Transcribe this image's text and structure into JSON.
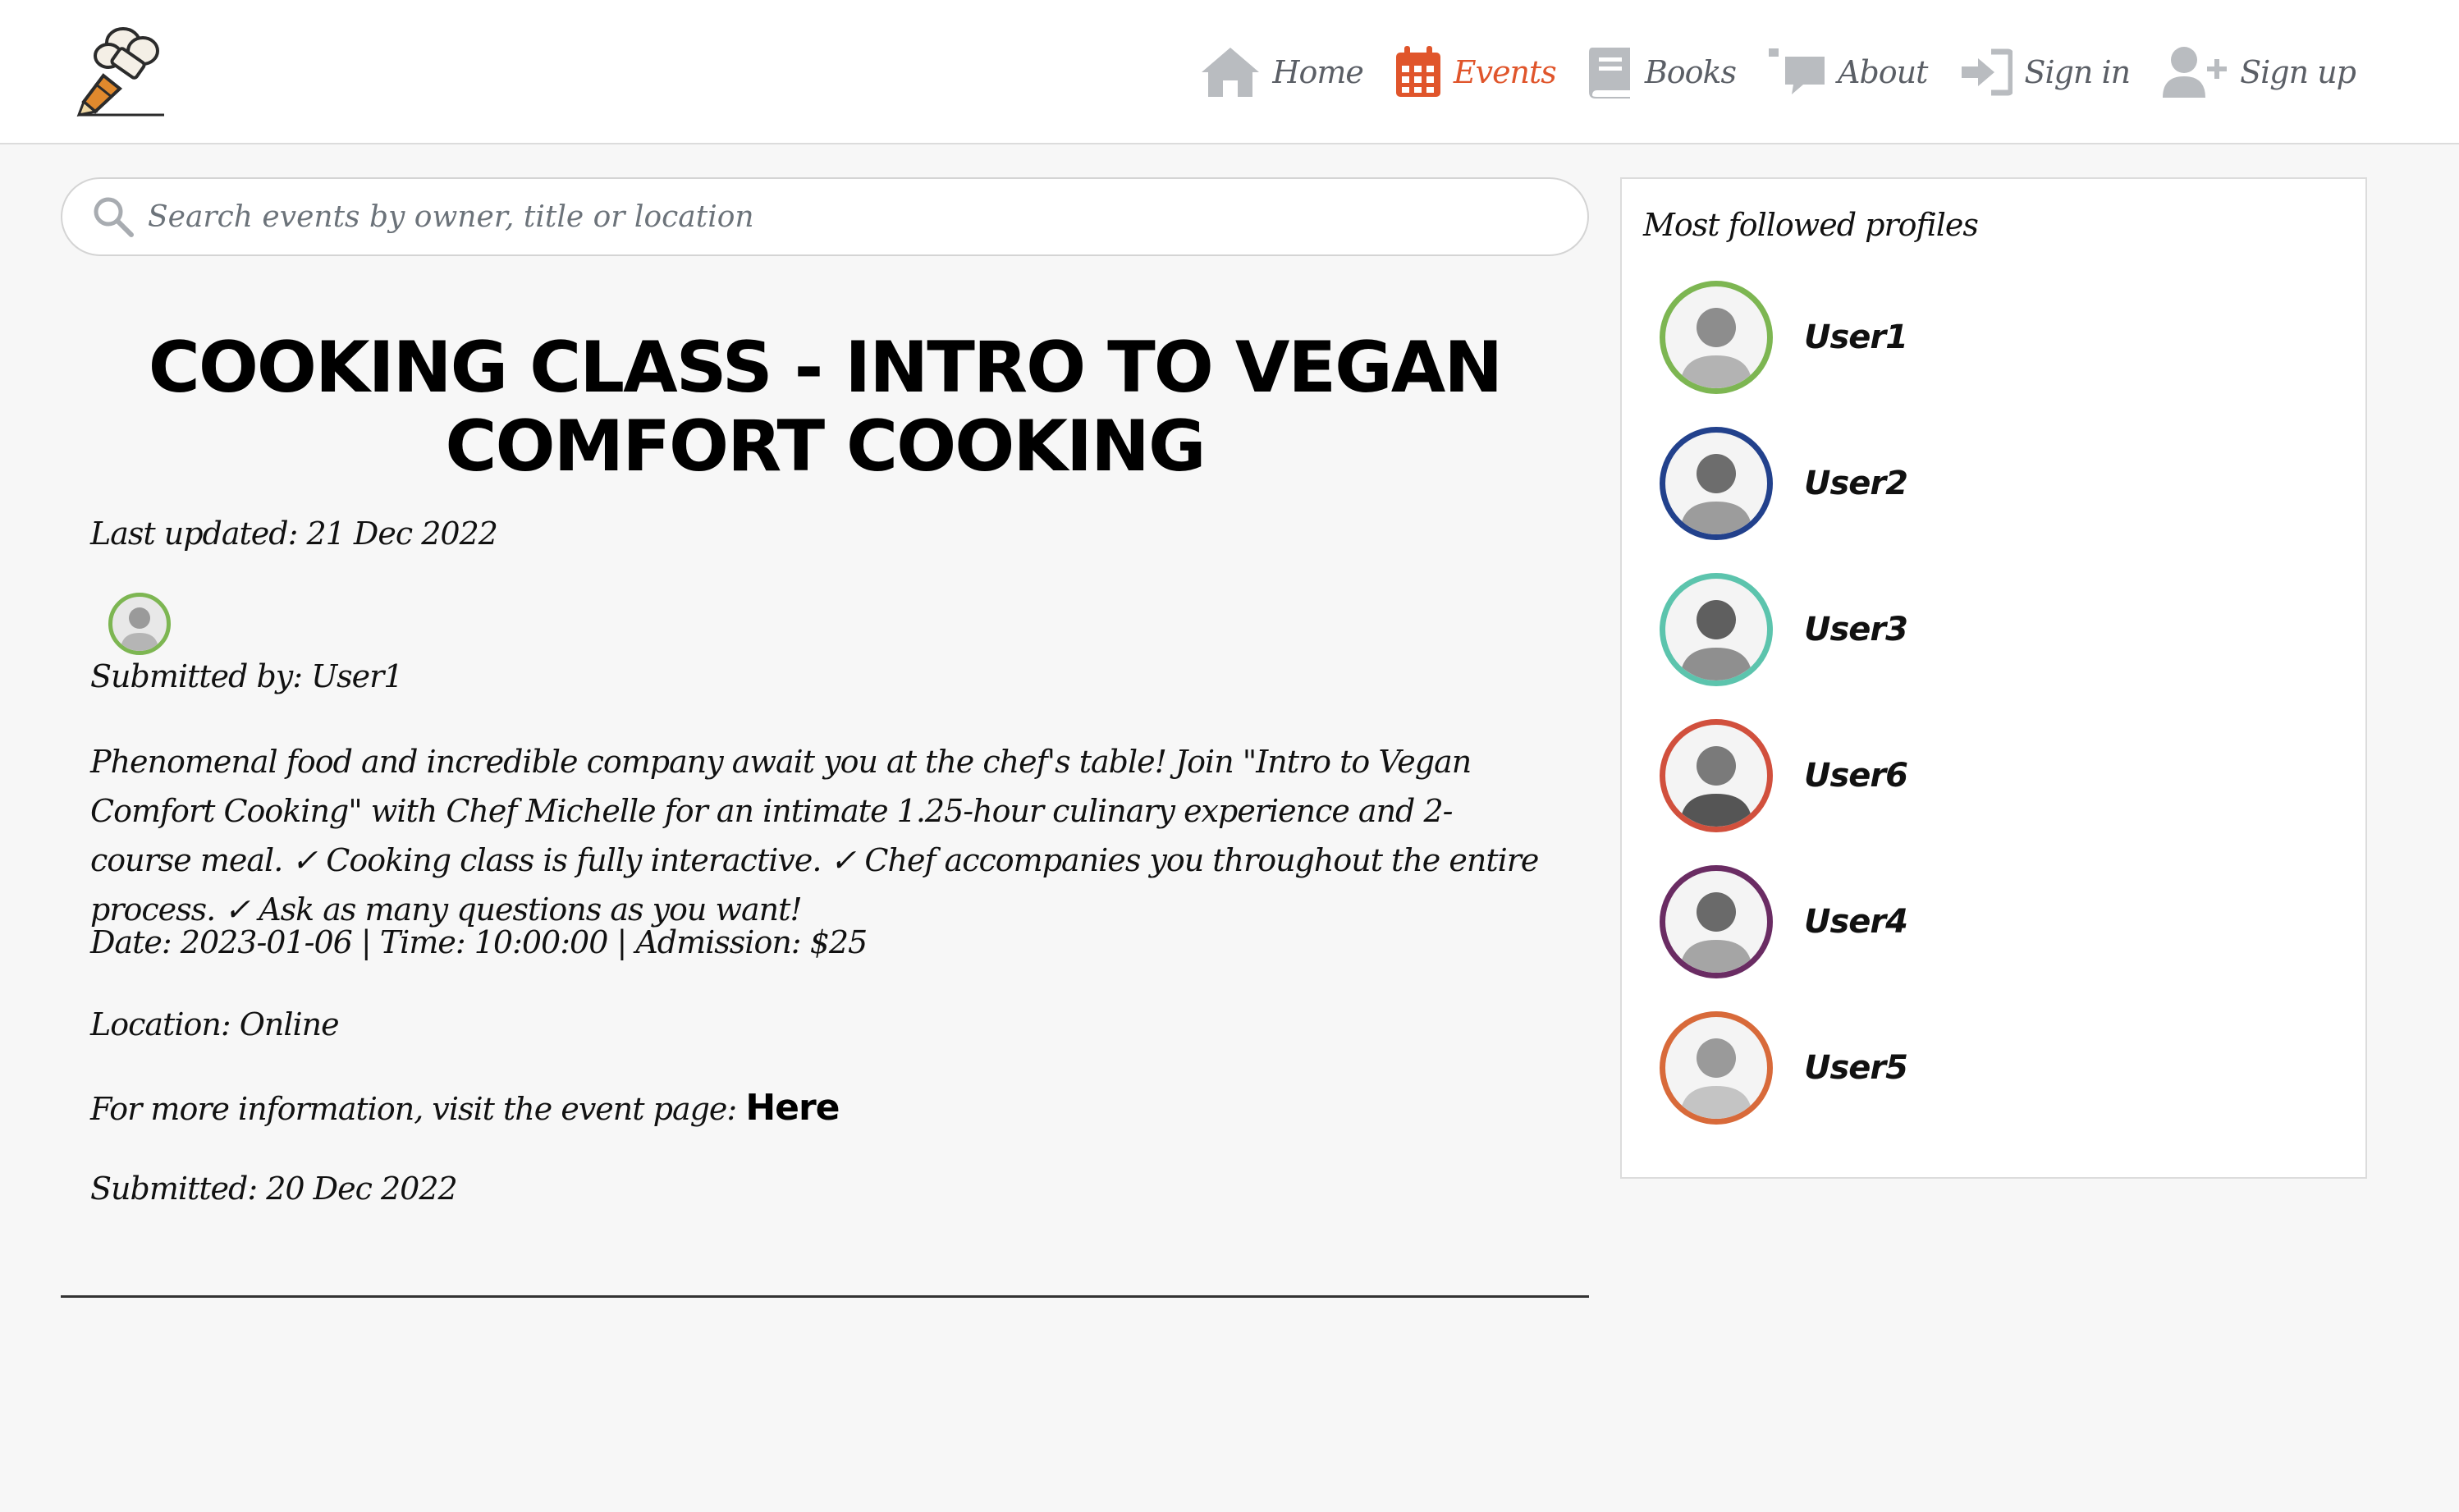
{
  "header": {
    "nav": [
      {
        "label": "Home",
        "icon": "home-icon",
        "active": false
      },
      {
        "label": "Events",
        "icon": "calendar-icon",
        "active": true
      },
      {
        "label": "Books",
        "icon": "book-icon",
        "active": false
      },
      {
        "label": "About",
        "icon": "comments-icon",
        "active": false
      },
      {
        "label": "Sign in",
        "icon": "sign-in-icon",
        "active": false
      },
      {
        "label": "Sign up",
        "icon": "user-plus-icon",
        "active": false
      }
    ]
  },
  "search": {
    "placeholder": "Search events by owner, title or location"
  },
  "event": {
    "title": "COOKING CLASS - INTRO TO VEGAN COMFORT COOKING",
    "last_updated": "Last updated: 21 Dec 2022",
    "submitted_by": "Submitted by: User1",
    "description": "Phenomenal food and incredible company await you at the chef's table! Join \"Intro to Vegan Comfort Cooking\" with Chef Michelle for an intimate 1.25-hour culinary experience and 2-course meal. ✓ Cooking class is fully interactive. ✓ Chef accompanies you throughout the entire process. ✓ Ask as many questions as you want!",
    "details": "Date: 2023-01-06 | Time: 10:00:00 | Admission: $25",
    "location": "Location: Online",
    "more_info": "For more information, visit the event page:",
    "link_label": "Here",
    "submitted": "Submitted: 20 Dec 2022"
  },
  "sidebar": {
    "title": "Most followed profiles",
    "profiles": [
      {
        "name": "User1",
        "ring_color": "#7db652"
      },
      {
        "name": "User2",
        "ring_color": "#22418c"
      },
      {
        "name": "User3",
        "ring_color": "#5cc4ad"
      },
      {
        "name": "User6",
        "ring_color": "#d1503d"
      },
      {
        "name": "User4",
        "ring_color": "#6a2c63"
      },
      {
        "name": "User5",
        "ring_color": "#d86a3a"
      }
    ]
  },
  "colors": {
    "accent": "#e0552b",
    "nav_text": "#5b5f66",
    "icon_grey": "#b9bcc0"
  }
}
